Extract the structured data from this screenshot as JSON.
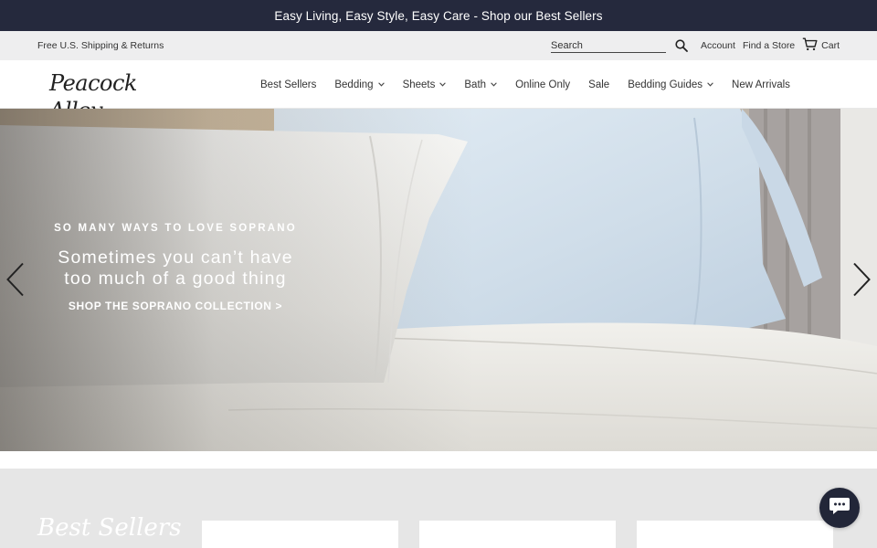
{
  "promo": {
    "text": "Easy Living, Easy Style, Easy Care - Shop our Best Sellers"
  },
  "utility": {
    "shipping": "Free U.S. Shipping & Returns",
    "search_placeholder": "Search",
    "account": "Account",
    "find_store": "Find a Store",
    "cart": "Cart"
  },
  "logo": {
    "text": "Peacock Alley"
  },
  "nav": {
    "items": [
      {
        "label": "Best Sellers",
        "dropdown": false
      },
      {
        "label": "Bedding",
        "dropdown": true
      },
      {
        "label": "Sheets",
        "dropdown": true
      },
      {
        "label": "Bath",
        "dropdown": true
      },
      {
        "label": "Online Only",
        "dropdown": false
      },
      {
        "label": "Sale",
        "dropdown": false
      },
      {
        "label": "Bedding Guides",
        "dropdown": true
      },
      {
        "label": "New Arrivals",
        "dropdown": false
      }
    ]
  },
  "hero": {
    "eyebrow": "SO MANY WAYS TO LOVE SOPRANO",
    "headline_line1": "Sometimes you can’t have",
    "headline_line2": "too much of a good thing",
    "cta": "SHOP THE SOPRANO COLLECTION >"
  },
  "best_sellers": {
    "title": "Best Sellers"
  },
  "icons": {
    "search": "search-icon",
    "cart": "cart-icon",
    "chevron": "chevron-down-icon",
    "prev": "chevron-left-icon",
    "next": "chevron-right-icon",
    "chat": "chat-icon"
  },
  "colors": {
    "promo_bg": "#25293d",
    "utility_bg": "#eeeeef",
    "chat_bg": "#222638"
  }
}
